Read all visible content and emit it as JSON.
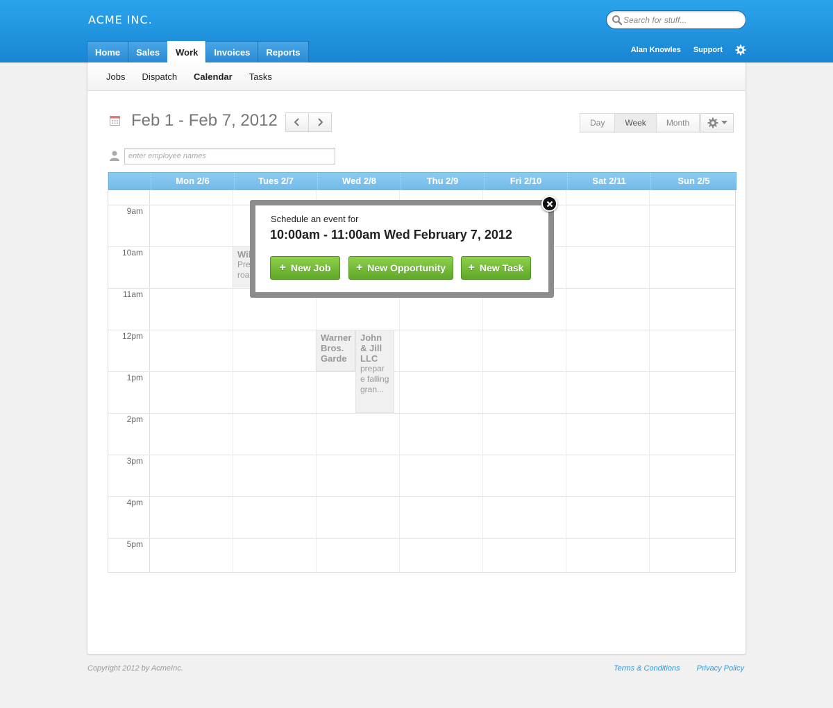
{
  "header": {
    "logo": "ACME INC.",
    "search_placeholder": "Search for stuff...",
    "tabs": [
      {
        "label": "Home"
      },
      {
        "label": "Sales"
      },
      {
        "label": "Work"
      },
      {
        "label": "Invoices"
      },
      {
        "label": "Reports"
      }
    ],
    "active_tab": "Work",
    "user_name": "Alan Knowles",
    "support_label": "Support"
  },
  "subnav": {
    "items": [
      {
        "label": "Jobs"
      },
      {
        "label": "Dispatch"
      },
      {
        "label": "Calendar"
      },
      {
        "label": "Tasks"
      }
    ],
    "active": "Calendar"
  },
  "toolbar": {
    "date_range": "Feb 1 - Feb 7, 2012",
    "views": [
      "Day",
      "Week",
      "Month"
    ],
    "active_view": "Week",
    "employee_placeholder": "enter employee names"
  },
  "calendar": {
    "days": [
      "Mon 2/6",
      "Tues 2/7",
      "Wed 2/8",
      "Thu 2/9",
      "Fri 2/10",
      "Sat 2/11",
      "Sun 2/5"
    ],
    "hours": [
      "9am",
      "10am",
      "11am",
      "12pm",
      "1pm",
      "2pm",
      "3pm",
      "4pm",
      "5pm"
    ],
    "events": [
      {
        "title": "Wile",
        "desc": "Prep roadi"
      },
      {
        "title": "Warner Bros. Garde",
        "desc": ""
      },
      {
        "title": "John & Jill LLC",
        "desc": "prepar e falling gran..."
      }
    ]
  },
  "modal": {
    "label": "Schedule an event for",
    "time": "10:00am - 11:00am Wed February 7, 2012",
    "buttons": [
      "New Job",
      "New Opportunity",
      "New Task"
    ]
  },
  "footer": {
    "copyright": "Copyright 2012 by AcmeInc.",
    "terms": "Terms & Conditions",
    "privacy": "Privacy Policy"
  },
  "colors": {
    "header_blue": "#1f95e0",
    "day_header": "#80c4ef",
    "button_green": "#6cb836",
    "link_blue": "#2f9ad9"
  }
}
